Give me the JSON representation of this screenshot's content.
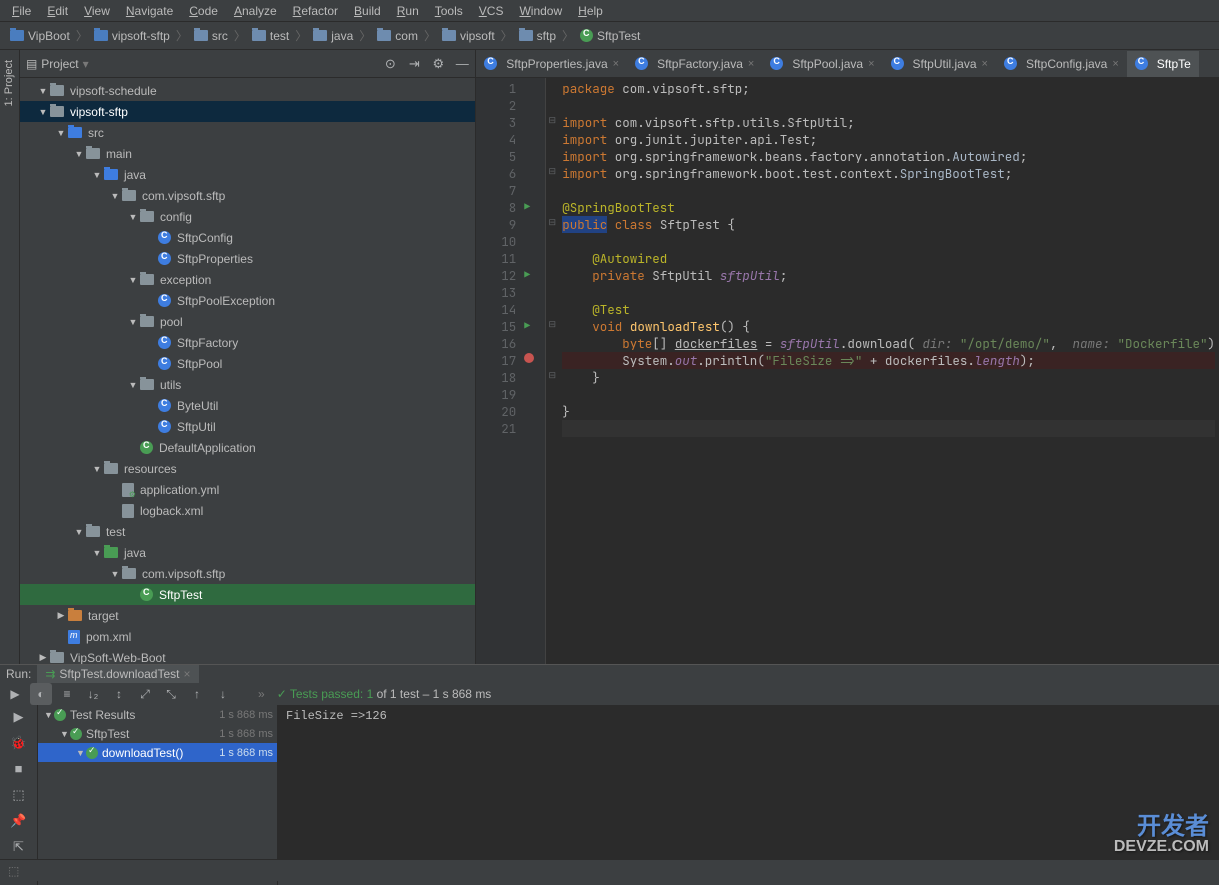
{
  "menu": [
    "File",
    "Edit",
    "View",
    "Navigate",
    "Code",
    "Analyze",
    "Refactor",
    "Build",
    "Run",
    "Tools",
    "VCS",
    "Window",
    "Help"
  ],
  "breadcrumbs": [
    {
      "icon": "folder-blue",
      "label": "VipBoot"
    },
    {
      "icon": "folder-blue",
      "label": "vipsoft-sftp"
    },
    {
      "icon": "folder",
      "label": "src"
    },
    {
      "icon": "folder",
      "label": "test"
    },
    {
      "icon": "folder",
      "label": "java"
    },
    {
      "icon": "folder",
      "label": "com"
    },
    {
      "icon": "folder",
      "label": "vipsoft"
    },
    {
      "icon": "folder",
      "label": "sftp"
    },
    {
      "icon": "class-green",
      "label": "SftpTest"
    }
  ],
  "project_title": "Project",
  "tree": [
    {
      "depth": 0,
      "caret": "▼",
      "icon": "folder-pkg",
      "label": "vipsoft-schedule"
    },
    {
      "depth": 0,
      "caret": "▼",
      "icon": "folder-pkg",
      "label": "vipsoft-sftp",
      "sel": "active"
    },
    {
      "depth": 1,
      "caret": "▼",
      "icon": "folder-src",
      "label": "src"
    },
    {
      "depth": 2,
      "caret": "▼",
      "icon": "folder-pkg",
      "label": "main"
    },
    {
      "depth": 3,
      "caret": "▼",
      "icon": "folder-src",
      "label": "java"
    },
    {
      "depth": 4,
      "caret": "▼",
      "icon": "folder-pkg",
      "label": "com.vipsoft.sftp"
    },
    {
      "depth": 5,
      "caret": "▼",
      "icon": "folder-pkg",
      "label": "config"
    },
    {
      "depth": 6,
      "caret": "",
      "icon": "class",
      "label": "SftpConfig"
    },
    {
      "depth": 6,
      "caret": "",
      "icon": "class",
      "label": "SftpProperties"
    },
    {
      "depth": 5,
      "caret": "▼",
      "icon": "folder-pkg",
      "label": "exception"
    },
    {
      "depth": 6,
      "caret": "",
      "icon": "class",
      "label": "SftpPoolException"
    },
    {
      "depth": 5,
      "caret": "▼",
      "icon": "folder-pkg",
      "label": "pool"
    },
    {
      "depth": 6,
      "caret": "",
      "icon": "class",
      "label": "SftpFactory"
    },
    {
      "depth": 6,
      "caret": "",
      "icon": "class",
      "label": "SftpPool"
    },
    {
      "depth": 5,
      "caret": "▼",
      "icon": "folder-pkg",
      "label": "utils"
    },
    {
      "depth": 6,
      "caret": "",
      "icon": "class",
      "label": "ByteUtil"
    },
    {
      "depth": 6,
      "caret": "",
      "icon": "class",
      "label": "SftpUtil"
    },
    {
      "depth": 5,
      "caret": "",
      "icon": "class-green",
      "label": "DefaultApplication"
    },
    {
      "depth": 3,
      "caret": "▼",
      "icon": "folder-res",
      "label": "resources"
    },
    {
      "depth": 4,
      "caret": "",
      "icon": "file-yml",
      "label": "application.yml"
    },
    {
      "depth": 4,
      "caret": "",
      "icon": "file",
      "label": "logback.xml"
    },
    {
      "depth": 2,
      "caret": "▼",
      "icon": "folder-pkg",
      "label": "test"
    },
    {
      "depth": 3,
      "caret": "▼",
      "icon": "folder-test",
      "label": "java"
    },
    {
      "depth": 4,
      "caret": "▼",
      "icon": "folder-pkg",
      "label": "com.vipsoft.sftp"
    },
    {
      "depth": 5,
      "caret": "",
      "icon": "class-green",
      "label": "SftpTest",
      "sel": "selected"
    },
    {
      "depth": 1,
      "caret": "▶",
      "icon": "folder-target",
      "label": "target"
    },
    {
      "depth": 1,
      "caret": "",
      "icon": "file-m",
      "label": "pom.xml"
    },
    {
      "depth": 0,
      "caret": "▶",
      "icon": "folder-pkg",
      "label": "VipSoft-Web-Boot"
    }
  ],
  "editor_tabs": [
    {
      "label": "SftpProperties.java",
      "active": false
    },
    {
      "label": "SftpFactory.java",
      "active": false
    },
    {
      "label": "SftpPool.java",
      "active": false
    },
    {
      "label": "SftpUtil.java",
      "active": false
    },
    {
      "label": "SftpConfig.java",
      "active": false
    },
    {
      "label": "SftpTe",
      "active": true
    }
  ],
  "code": {
    "lines": [
      {
        "n": 1,
        "html": "<span class='kw'>package</span> com.vipsoft.sftp;"
      },
      {
        "n": 2,
        "html": ""
      },
      {
        "n": 3,
        "fold": "⊟",
        "html": "<span class='kw'>import</span> com.vipsoft.sftp.utils.SftpUtil;"
      },
      {
        "n": 4,
        "html": "<span class='kw'>import</span> org.junit.jupiter.api.Test;"
      },
      {
        "n": 5,
        "html": "<span class='kw'>import</span> org.springframework.beans.factory.annotation.<span class='type'>Autowired</span>;"
      },
      {
        "n": 6,
        "fold": "⊟",
        "html": "<span class='kw'>import</span> org.springframework.boot.test.context.<span class='type'>SpringBootTest</span>;"
      },
      {
        "n": 7,
        "html": ""
      },
      {
        "n": 8,
        "mark": "run",
        "html": "<span class='an'>@SpringBootTest</span>"
      },
      {
        "n": 9,
        "fold": "⊟",
        "html": "<span class='kw hl'>public</span> <span class='kw'>class</span> SftpTest {"
      },
      {
        "n": 10,
        "html": ""
      },
      {
        "n": 11,
        "html": "    <span class='an'>@Autowired</span>"
      },
      {
        "n": 12,
        "mark": "run",
        "html": "    <span class='kw'>private</span> SftpUtil <span class='field'>sftpUtil</span>;"
      },
      {
        "n": 13,
        "html": ""
      },
      {
        "n": 14,
        "html": "    <span class='an'>@Test</span>"
      },
      {
        "n": 15,
        "mark": "run",
        "fold": "⊟",
        "html": "    <span class='kw'>void</span> <span class='fn'>downloadTest</span>() {"
      },
      {
        "n": 16,
        "html": "        <span class='kw'>byte</span>[] <u>dockerfiles</u> = <span class='field'>sftpUtil</span>.download( <span class='param-hint'>dir:</span> <span class='str'>\"/opt/demo/\"</span>,  <span class='param-hint'>name:</span> <span class='str'>\"Dockerfile\"</span>)"
      },
      {
        "n": 17,
        "mark": "bp",
        "cls": "breakpoint-line",
        "html": "        System.<span class='field'>out</span>.println(<span class='str'>\"FileSize =>\"</span> + dockerfiles.<span class='field'>length</span>);"
      },
      {
        "n": 18,
        "fold": "⊟",
        "html": "    }"
      },
      {
        "n": 19,
        "html": ""
      },
      {
        "n": 20,
        "html": "}"
      },
      {
        "n": 21,
        "cls": "hl-current",
        "html": ""
      }
    ]
  },
  "run": {
    "label": "Run:",
    "tab": "SftpTest.downloadTest",
    "status_pass": "✓ Tests passed: 1",
    "status_rest": " of 1 test – 1 s 868 ms",
    "tests": [
      {
        "depth": 0,
        "label": "Test Results",
        "time": "1 s 868 ms"
      },
      {
        "depth": 1,
        "label": "SftpTest",
        "time": "1 s 868 ms"
      },
      {
        "depth": 2,
        "label": "downloadTest()",
        "time": "1 s 868 ms",
        "sel": true
      }
    ],
    "console": "FileSize =>126"
  },
  "watermark": {
    "top": "开发者",
    "bottom": "DEVZE.COM"
  }
}
